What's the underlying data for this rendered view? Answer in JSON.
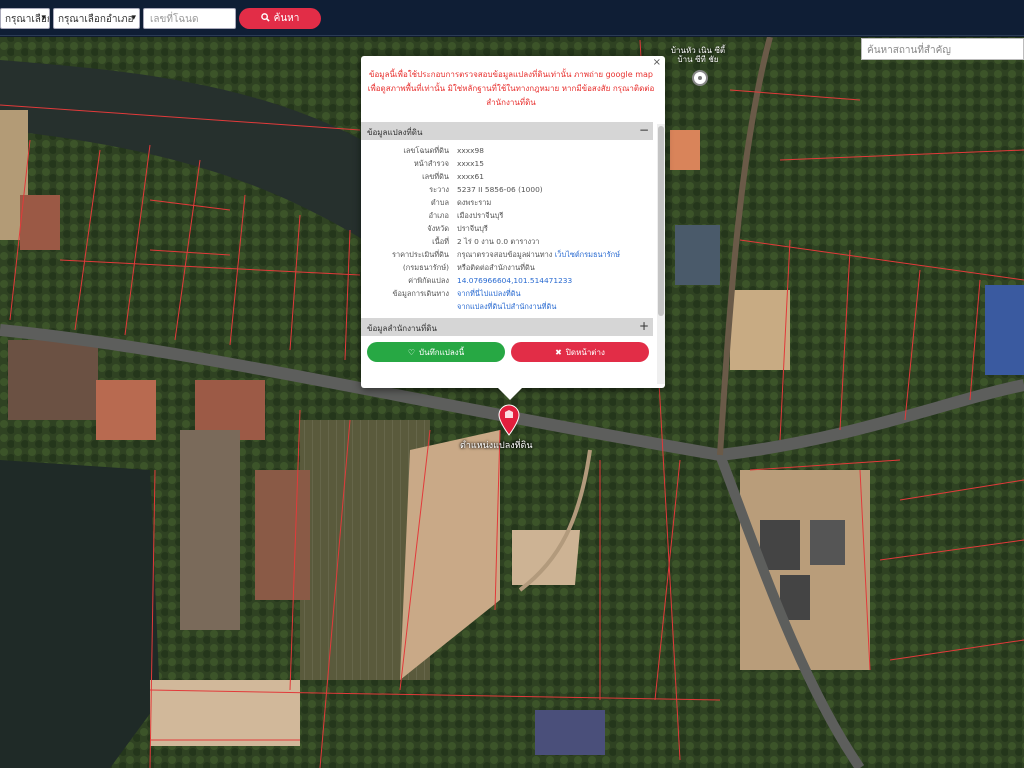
{
  "toolbar": {
    "province_select": "กรุณาเลือกจังหวัด",
    "district_select": "กรุณาเลือกอำเภอ",
    "deed_placeholder": "เลขที่โฉนด",
    "search_label": "ค้นหา"
  },
  "map": {
    "landmark_placeholder": "ค้นหาสถานที่สำคัญ",
    "village_label": "บ้านหัว เนิน ซีตี้",
    "village_sub": "บ้าน ซีที ชัย",
    "marker_label": "ตำแหน่งแปลงที่ดิน"
  },
  "popup": {
    "warning": "ข้อมูลนี้เพื่อใช้ประกอบการตรวจสอบข้อมูลแปลงที่ดินเท่านั้น ภาพถ่าย google map เพื่อดูสภาพพื้นที่เท่านั้น มิใช่หลักฐานที่ใช้ในทางกฎหมาย หากมีข้อสงสัย กรุณาติดต่อสำนักงานที่ดิน",
    "section_land": "ข้อมูลแปลงที่ดิน",
    "section_office": "ข้อมูลสำนักงานที่ดิน",
    "rows": [
      {
        "label": "เลขโฉนดที่ดิน",
        "value": "xxxx98"
      },
      {
        "label": "หน้าสำรวจ",
        "value": "xxxx15"
      },
      {
        "label": "เลขที่ดิน",
        "value": "xxxx61"
      },
      {
        "label": "ระวาง",
        "value": "5237 II 5856-06 (1000)"
      },
      {
        "label": "ตำบล",
        "value": "ดงพระราม"
      },
      {
        "label": "อำเภอ",
        "value": "เมืองปราจีนบุรี"
      },
      {
        "label": "จังหวัด",
        "value": "ปราจีนบุรี"
      },
      {
        "label": "เนื้อที่",
        "value": "2 ไร่ 0 งาน 0.0 ตารางวา"
      },
      {
        "label": "ราคาประเมินที่ดิน",
        "value": "กรุณาตรวจสอบข้อมูลผ่านทาง",
        "link": "เว็บไซต์กรมธนารักษ์"
      },
      {
        "label": "(กรมธนารักษ์)",
        "value": "หรือติดต่อสำนักงานที่ดิน"
      },
      {
        "label": "ค่าพิกัดแปลง",
        "value": "",
        "link": "14.076966604,101.514471233"
      },
      {
        "label": "ข้อมูลการเดินทาง",
        "value": "",
        "link": "จากที่นี่ไปแปลงที่ดิน"
      },
      {
        "label": "",
        "value": "",
        "link": "จากแปลงที่ดินไปสำนักงานที่ดิน"
      }
    ],
    "save_label": "บันทึกแปลงนี้",
    "close_label": "ปิดหน้าต่าง"
  },
  "colors": {
    "accent": "#e22d47",
    "save": "#27a844",
    "topbar": "#0f1e35",
    "parcel_line": "#e23a3a"
  }
}
